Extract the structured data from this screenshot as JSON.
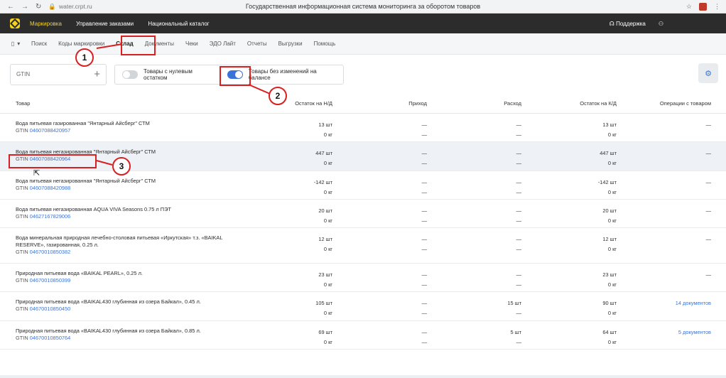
{
  "browser": {
    "url": "water.crpt.ru",
    "title": "Государственная информационная система мониторинга за оборотом товаров"
  },
  "topnav": {
    "items": [
      "Маркировка",
      "Управление заказами",
      "Национальный каталог"
    ],
    "support": "Поддержка"
  },
  "subnav": {
    "tabs": [
      "Поиск",
      "Коды маркировки",
      "Склад",
      "Документы",
      "Чеки",
      "ЭДО Лайт",
      "Отчеты",
      "Выгрузки",
      "Помощь"
    ],
    "active": "Склад"
  },
  "filters": {
    "gtin_placeholder": "GTIN",
    "toggle_zero": "Товары с нулевым остатком",
    "toggle_no_change": "Товары без изменений на балансе"
  },
  "table": {
    "headers": [
      "Товар",
      "Остаток на Н/Д",
      "Приход",
      "Расход",
      "Остаток на К/Д",
      "Операции с товаром"
    ],
    "rows": [
      {
        "name": "Вода питьевая газированная \"Янтарный Айсберг\" СТМ",
        "gtin_prefix": "GTIN",
        "gtin": "04607088420957",
        "start_qty": "13 шт",
        "start_kg": "0 кг",
        "in": "—",
        "in2": "—",
        "out": "—",
        "out2": "—",
        "end_qty": "13 шт",
        "end_kg": "0 кг",
        "ops": "—"
      },
      {
        "name": "Вода питьевая негазированная \"Янтарный Айсберг\" СТМ",
        "gtin_prefix": "GTIN",
        "gtin": "04607088420964",
        "start_qty": "447 шт",
        "start_kg": "0 кг",
        "in": "—",
        "in2": "—",
        "out": "—",
        "out2": "—",
        "end_qty": "447 шт",
        "end_kg": "0 кг",
        "ops": "—"
      },
      {
        "name": "Вода питьевая негазированная \"Янтарный Айсберг\" СТМ",
        "gtin_prefix": "GTIN",
        "gtin": "04607088420988",
        "start_qty": "-142 шт",
        "start_kg": "0 кг",
        "in": "—",
        "in2": "—",
        "out": "—",
        "out2": "—",
        "end_qty": "-142 шт",
        "end_kg": "0 кг",
        "ops": "—"
      },
      {
        "name": "Вода питьевая негазированная AQUA VIVA Seasons 0.75 л ПЭТ",
        "gtin_prefix": "GTIN",
        "gtin": "04627167829006",
        "start_qty": "20 шт",
        "start_kg": "0 кг",
        "in": "—",
        "in2": "—",
        "out": "—",
        "out2": "—",
        "end_qty": "20 шт",
        "end_kg": "0 кг",
        "ops": "—"
      },
      {
        "name": "Вода минеральная природная лечебно-столовая питьевая «Иркутская» т.з. «BAIKAL",
        "name2": "RESERVE», газированная, 0.25 л.",
        "gtin_prefix": "GTIN",
        "gtin": "04670010850382",
        "start_qty": "12 шт",
        "start_kg": "0 кг",
        "in": "—",
        "in2": "—",
        "out": "—",
        "out2": "—",
        "end_qty": "12 шт",
        "end_kg": "0 кг",
        "ops": "—"
      },
      {
        "name": "Природная питьевая вода «BAIKAL PEARL», 0.25 л.",
        "gtin_prefix": "GTIN",
        "gtin": "04670010850399",
        "start_qty": "23 шт",
        "start_kg": "0 кг",
        "in": "—",
        "in2": "—",
        "out": "—",
        "out2": "—",
        "end_qty": "23 шт",
        "end_kg": "0 кг",
        "ops": "—"
      },
      {
        "name": "Природная питьевая вода «BAIKAL430 глубинная из озера Байкал», 0.45 л.",
        "gtin_prefix": "GTIN",
        "gtin": "04670010850450",
        "start_qty": "105 шт",
        "start_kg": "0 кг",
        "in": "—",
        "in2": "—",
        "out": "15 шт",
        "out2": "—",
        "end_qty": "90 шт",
        "end_kg": "0 кг",
        "ops": "14 документов"
      },
      {
        "name": "Природная питьевая вода «BAIKAL430 глубинная из озера Байкал», 0.85 л.",
        "gtin_prefix": "GTIN",
        "gtin": "04670010850764",
        "start_qty": "69 шт",
        "start_kg": "0 кг",
        "in": "—",
        "in2": "—",
        "out": "5 шт",
        "out2": "—",
        "end_qty": "64 шт",
        "end_kg": "0 кг",
        "ops": "5 документов"
      }
    ]
  },
  "annotations": [
    "1",
    "2",
    "3"
  ]
}
